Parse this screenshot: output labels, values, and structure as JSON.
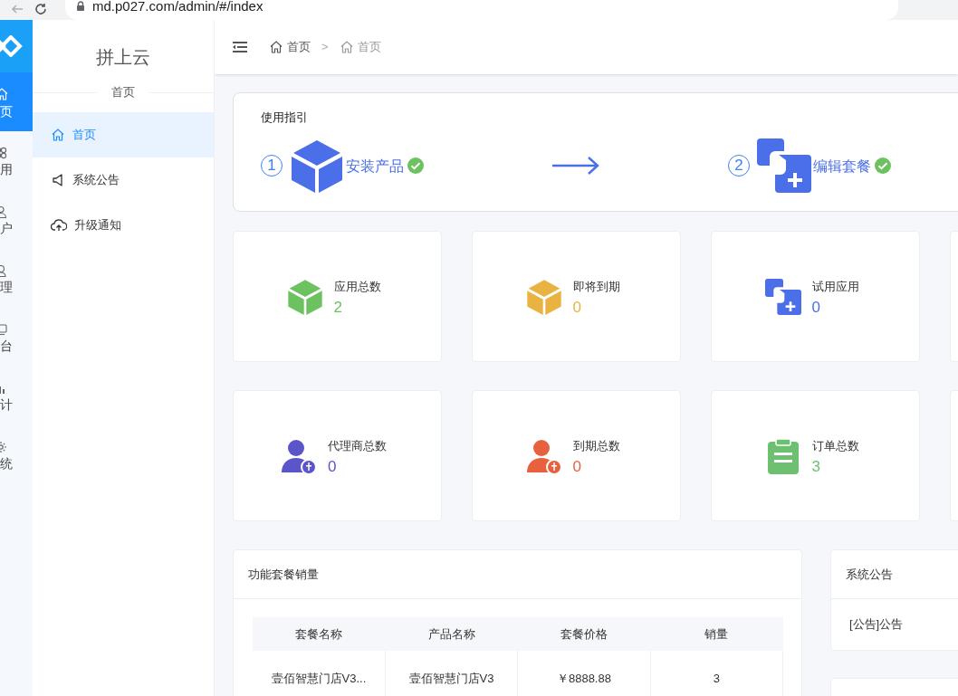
{
  "browser": {
    "url": "md.p027.com/admin/#/index"
  },
  "rail": [
    {
      "label": "页",
      "kind": "home",
      "selected": true
    },
    {
      "label": "用",
      "kind": "apps",
      "selected": false
    },
    {
      "label": "户",
      "kind": "user",
      "selected": false
    },
    {
      "label": "理",
      "kind": "agent",
      "selected": false
    },
    {
      "label": "台",
      "kind": "screen",
      "selected": false
    },
    {
      "label": "计",
      "kind": "chart",
      "selected": false
    },
    {
      "label": "统",
      "kind": "gear",
      "selected": false
    }
  ],
  "sidebar": {
    "title": "拼上云",
    "subtitle": "首页",
    "items": [
      {
        "label": "首页",
        "kind": "home",
        "selected": true
      },
      {
        "label": "系统公告",
        "kind": "speaker",
        "selected": false
      },
      {
        "label": "升级通知",
        "kind": "cloud",
        "selected": false
      }
    ]
  },
  "breadcrumb": {
    "separator": ">",
    "items": [
      {
        "label": "首页",
        "current": false
      },
      {
        "label": "首页",
        "current": true
      }
    ]
  },
  "guide": {
    "title": "使用指引",
    "steps": [
      {
        "number": "1",
        "label": "安装产品",
        "kind": "cube",
        "done": true
      },
      {
        "number": "2",
        "label": "编辑套餐",
        "kind": "copy",
        "done": true
      }
    ]
  },
  "stats": [
    {
      "label": "应用总数",
      "value": "2",
      "kind": "cube",
      "color": "#6cc160"
    },
    {
      "label": "即将到期",
      "value": "0",
      "kind": "cube",
      "color": "#e9b341"
    },
    {
      "label": "试用应用",
      "value": "0",
      "kind": "copy",
      "color": "#4a6fe8"
    },
    {
      "label": "代理商总数",
      "value": "0",
      "kind": "person",
      "color": "#5a55c9"
    },
    {
      "label": "到期总数",
      "value": "0",
      "kind": "person",
      "color": "#e8613f"
    },
    {
      "label": "订单总数",
      "value": "3",
      "kind": "clipboard",
      "color": "#6cc070"
    }
  ],
  "sales": {
    "title": "功能套餐销量",
    "columns": [
      "套餐名称",
      "产品名称",
      "套餐价格",
      "销量"
    ],
    "rows": [
      [
        "壹佰智慧门店V3...",
        "壹佰智慧门店V3",
        "￥8888.88",
        "3"
      ]
    ]
  },
  "notice": {
    "title": "系统公告",
    "items": [
      "[公告]公告"
    ]
  }
}
